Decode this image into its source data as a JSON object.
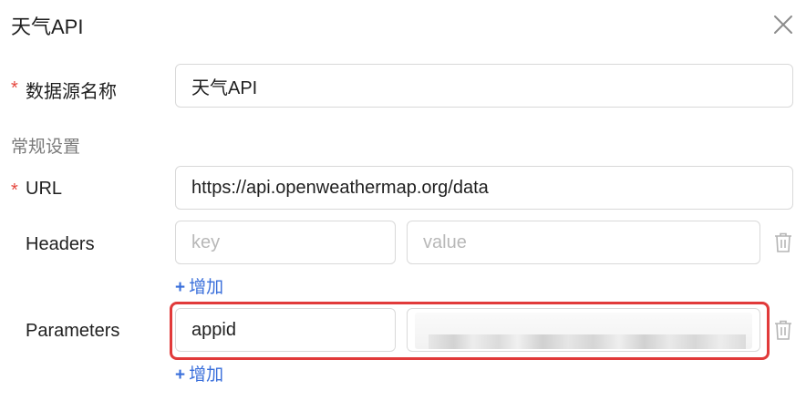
{
  "dialog": {
    "title": "天气API",
    "close_icon": "close-icon"
  },
  "form": {
    "required_mark": "*",
    "datasource_name": {
      "label": "数据源名称",
      "value": "天气API"
    },
    "section_general": "常规设置",
    "url": {
      "label": "URL",
      "value": "https://api.openweathermap.org/data"
    },
    "headers": {
      "label": "Headers",
      "key_placeholder": "key",
      "value_placeholder": "value",
      "delete_icon": "trash-icon",
      "add_label": "增加"
    },
    "parameters": {
      "label": "Parameters",
      "key_value": "appid",
      "value_blurred": true,
      "delete_icon": "trash-icon",
      "add_label": "增加"
    }
  },
  "colors": {
    "required": "#e5483f",
    "link": "#3a6fdb",
    "highlight_border": "#e13a3a"
  }
}
